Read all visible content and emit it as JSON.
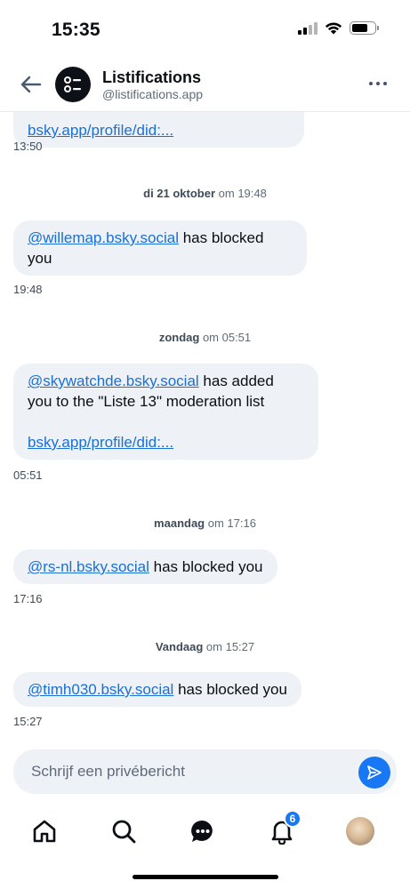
{
  "status_bar": {
    "time": "15:35"
  },
  "header": {
    "name": "Listifications",
    "handle": "@listifications.app"
  },
  "messages": [
    {
      "link": "bsky.app/profile/did:...",
      "time": "13:50"
    },
    {
      "date_bold": "di 21 oktober",
      "date_rest": " om 19:48",
      "handle": "@willemap.bsky.social",
      "text": " has blocked",
      "text2": "you",
      "time": "19:48"
    },
    {
      "date_bold": "zondag",
      "date_rest": " om 05:51",
      "handle": "@skywatchde.bsky.social",
      "text": " has added",
      "text2": "you to the \"Liste 13\" moderation list",
      "link": "bsky.app/profile/did:...",
      "time": "05:51"
    },
    {
      "date_bold": "maandag",
      "date_rest": " om 17:16",
      "handle": "@rs-nl.bsky.social",
      "text": " has blocked you",
      "time": "17:16"
    },
    {
      "date_bold": "Vandaag",
      "date_rest": " om 15:27",
      "handle": "@timh030.bsky.social",
      "text": " has blocked you",
      "time": "15:27"
    }
  ],
  "composer": {
    "placeholder": "Schrijf een privébericht"
  },
  "tabbar": {
    "notifications_badge": "6"
  },
  "colors": {
    "accent": "#1877f2",
    "bubble": "#eef2f6",
    "link": "#1a6fd8"
  },
  "icons": [
    "back-arrow-icon",
    "list-logo-icon",
    "more-dots-icon",
    "send-icon",
    "home-icon",
    "search-icon",
    "chat-icon",
    "bell-icon",
    "profile-avatar"
  ]
}
